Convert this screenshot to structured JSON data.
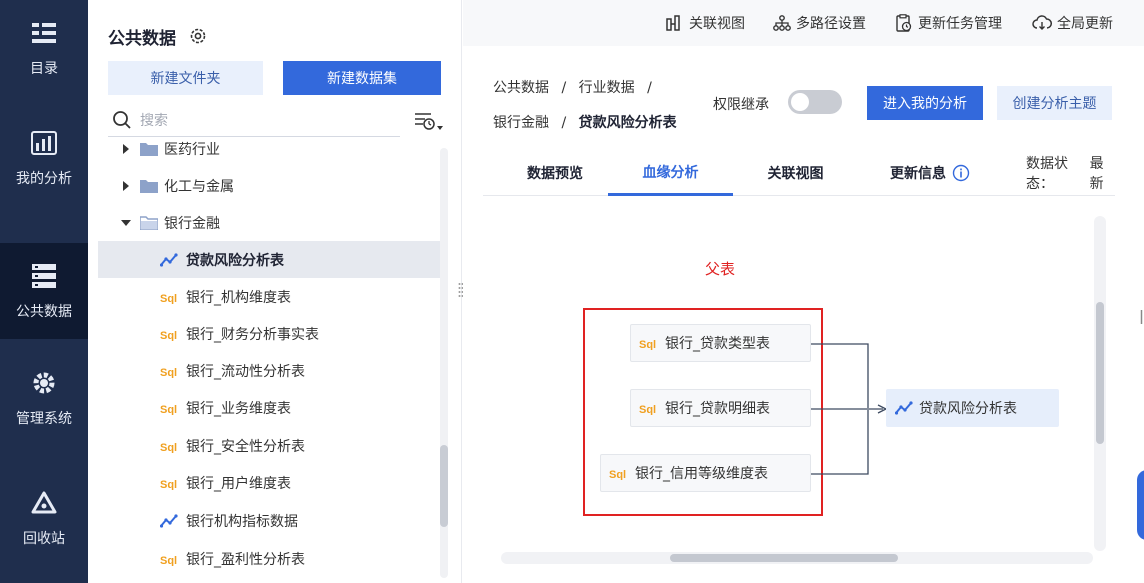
{
  "nav": {
    "items": [
      {
        "label": "目录",
        "icon": "catalog-icon"
      },
      {
        "label": "我的分析",
        "icon": "analysis-chart-icon"
      },
      {
        "label": "公共数据",
        "icon": "server-stack-icon",
        "active": true
      },
      {
        "label": "管理系统",
        "icon": "settings-gear-icon"
      },
      {
        "label": "回收站",
        "icon": "recycle-icon"
      }
    ]
  },
  "sidebar": {
    "title": "公共数据",
    "new_folder": "新建文件夹",
    "new_dataset": "新建数据集",
    "search_placeholder": "搜索",
    "tree": [
      {
        "label": "医药行业",
        "type": "folder",
        "expanded": false
      },
      {
        "label": "化工与金属",
        "type": "folder",
        "expanded": false
      },
      {
        "label": "银行金融",
        "type": "folder",
        "expanded": true
      },
      {
        "label": "贷款风险分析表",
        "type": "analysis",
        "selected": true
      },
      {
        "label": "银行_机构维度表",
        "type": "sql"
      },
      {
        "label": "银行_财务分析事实表",
        "type": "sql"
      },
      {
        "label": "银行_流动性分析表",
        "type": "sql"
      },
      {
        "label": "银行_业务维度表",
        "type": "sql"
      },
      {
        "label": "银行_安全性分析表",
        "type": "sql"
      },
      {
        "label": "银行_用户维度表",
        "type": "sql"
      },
      {
        "label": "银行机构指标数据",
        "type": "analysis"
      },
      {
        "label": "银行_盈利性分析表",
        "type": "sql"
      }
    ]
  },
  "topbar": {
    "relation_view": "关联视图",
    "multipath": "多路径设置",
    "update_tasks": "更新任务管理",
    "global_update": "全局更新"
  },
  "breadcrumb": {
    "part1": "公共数据",
    "sep": "/",
    "part2": "行业数据",
    "part3": "银行金融",
    "current": "贷款风险分析表"
  },
  "actions": {
    "permission_inherit": "权限继承",
    "enter_analysis": "进入我的分析",
    "create_topic": "创建分析主题"
  },
  "tabs": {
    "preview": "数据预览",
    "lineage": "血缘分析",
    "relation": "关联视图",
    "update_info": "更新信息",
    "status_label": "数据状态：",
    "status_value": "最新"
  },
  "lineage": {
    "parent_label": "父表",
    "parents": [
      "银行_贷款类型表",
      "银行_贷款明细表",
      "银行_信用等级维度表"
    ],
    "target": "贷款风险分析表"
  },
  "colors": {
    "nav_bg": "#1f2e4d",
    "primary": "#3369dc",
    "highlight_red": "#e02222",
    "sql_orange": "#f0a020"
  }
}
